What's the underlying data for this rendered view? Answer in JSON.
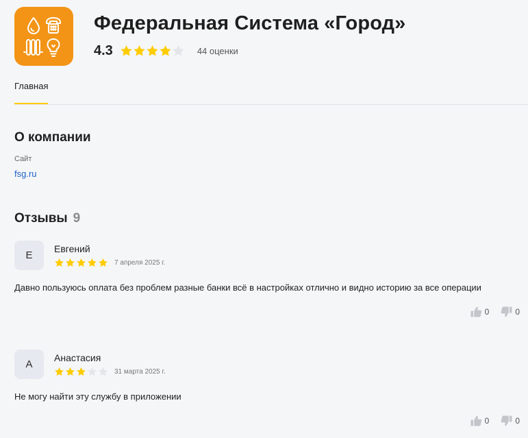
{
  "company": {
    "title": "Федеральная Система «Город»",
    "rating": "4.3",
    "rating_stars": 4,
    "rating_count": "44 оценки",
    "logo_color": "#f39416",
    "logo_icons": [
      "water-drop-icon",
      "telephone-icon",
      "radiator-icon",
      "lightbulb-icon"
    ]
  },
  "tabs": [
    {
      "label": "Главная",
      "active": true
    }
  ],
  "about": {
    "title": "О компании",
    "site_label": "Сайт",
    "site_link": "fsg.ru"
  },
  "reviews": {
    "title": "Отзывы",
    "count": "9",
    "items": [
      {
        "avatar_letter": "Е",
        "name": "Евгений",
        "stars": 5,
        "date": "7 апреля 2025 г.",
        "text": "Давно пользуюсь оплата без проблем разные банки всё в настройках отлично и видно историю за все операции",
        "likes": "0",
        "dislikes": "0"
      },
      {
        "avatar_letter": "А",
        "name": "Анастасия",
        "stars": 3,
        "date": "31 марта 2025 г.",
        "text": "Не могу найти эту службу в приложении",
        "likes": "0",
        "dislikes": "0"
      }
    ]
  },
  "colors": {
    "star_filled": "#ffcc00",
    "star_empty": "#e3e5e8",
    "tab_underline": "#ffcc00",
    "link": "#1e62c9",
    "vote_icon": "#c2c5ca"
  }
}
